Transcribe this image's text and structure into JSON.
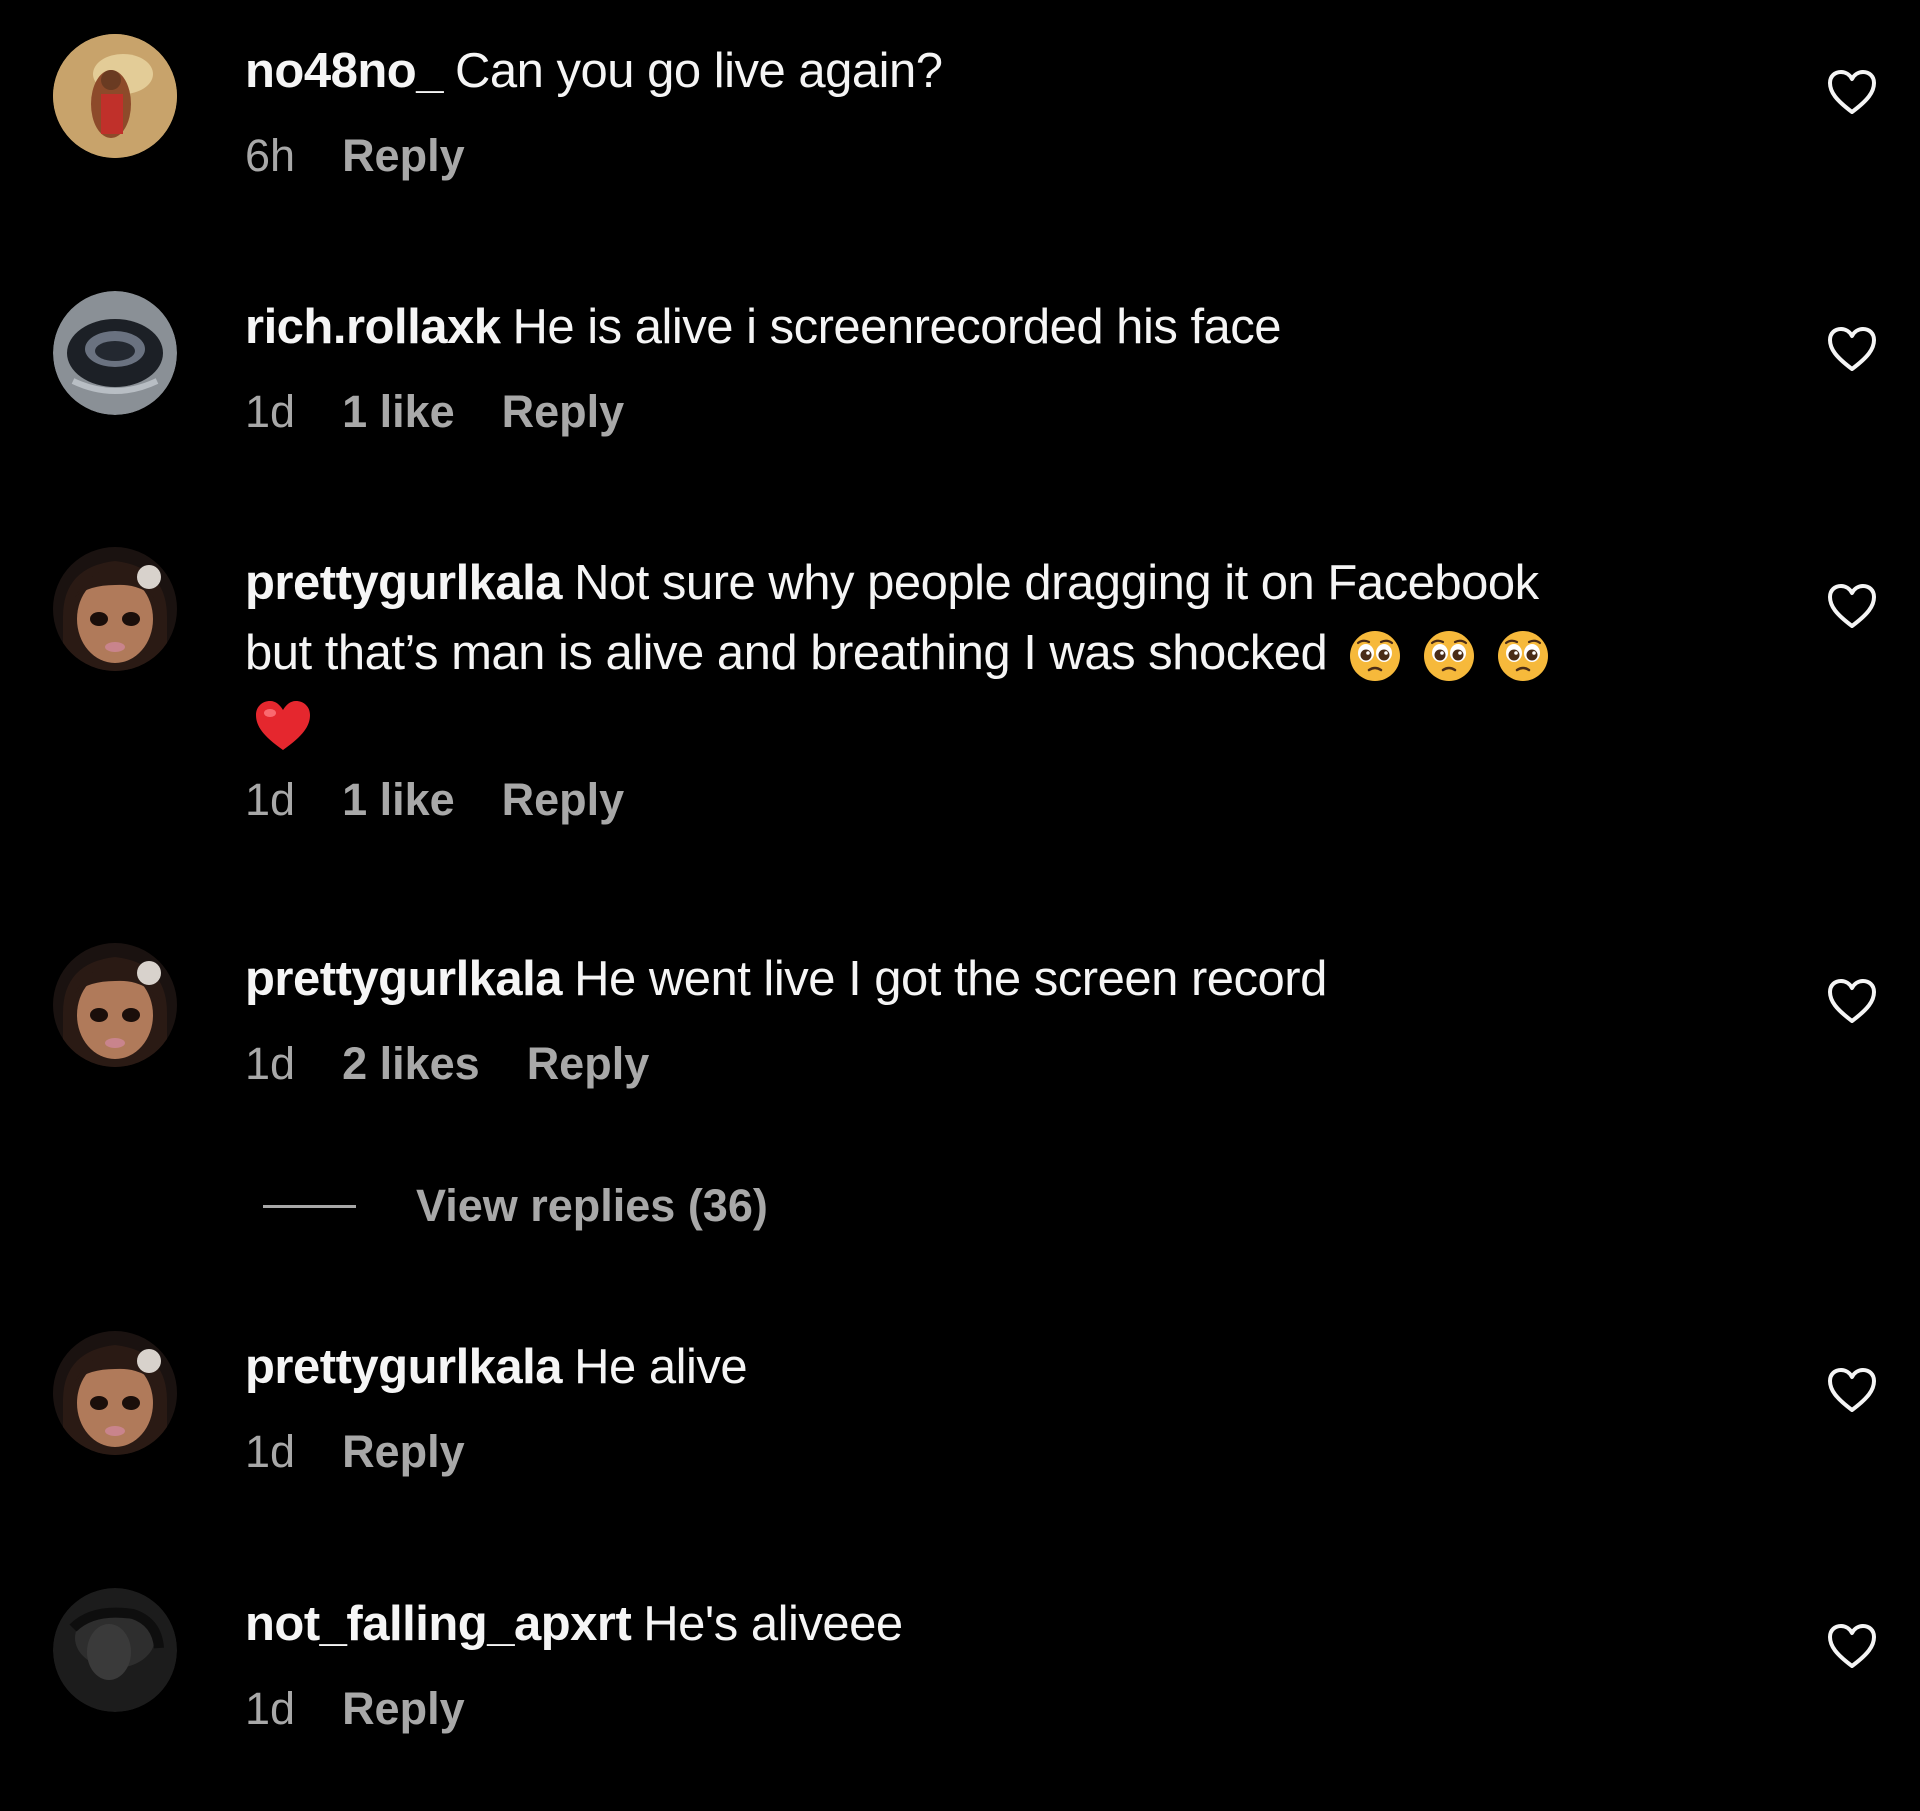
{
  "comments": [
    {
      "username": "no48no_",
      "text": "Can you go live again?",
      "time": "6h",
      "likes": "",
      "reply": "Reply"
    },
    {
      "username": "rich.rollaxk",
      "text": "He is alive i screenrecorded his face",
      "time": "1d",
      "likes": "1 like",
      "reply": "Reply"
    },
    {
      "username": "prettygurlkala",
      "text_line1": "Not sure why people dragging it on Facebook",
      "text_line2": "but that’s man is alive and breathing I was shocked",
      "emojis": [
        "pleading-face",
        "pleading-face",
        "pleading-face",
        "red-heart"
      ],
      "time": "1d",
      "likes": "1 like",
      "reply": "Reply"
    },
    {
      "username": "prettygurlkala",
      "text": "He went live I got the screen record",
      "time": "1d",
      "likes": "2 likes",
      "reply": "Reply",
      "view_replies": "View replies (36)"
    },
    {
      "username": "prettygurlkala",
      "text": "He alive",
      "time": "1d",
      "likes": "",
      "reply": "Reply"
    },
    {
      "username": "not_falling_apxrt",
      "text": "He's aliveee",
      "time": "1d",
      "likes": "",
      "reply": "Reply"
    }
  ],
  "icons": {
    "like": "heart-outline-icon"
  },
  "colors": {
    "background": "#000000",
    "text": "#f5f5f5",
    "meta": "#a8a8a8"
  }
}
